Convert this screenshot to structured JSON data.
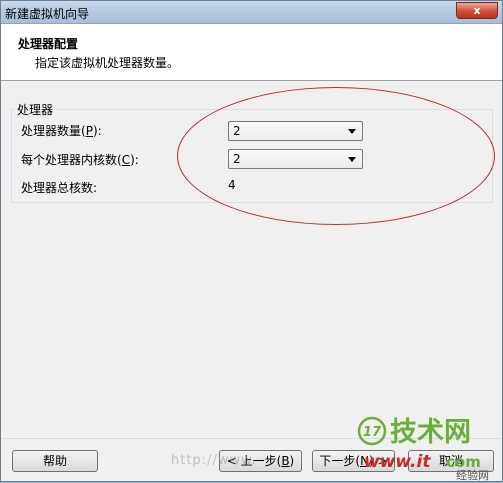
{
  "window": {
    "title": "新建虚拟机向导",
    "close_glyph": "x"
  },
  "header": {
    "title": "处理器配置",
    "subtitle": "指定该虚拟机处理器数量。"
  },
  "group": {
    "title": "处理器",
    "rows": [
      {
        "label_prefix": "处理器数量(",
        "accel": "P",
        "label_suffix": "):",
        "value": "2"
      },
      {
        "label_prefix": "每个处理器内核数(",
        "accel": "C",
        "label_suffix": "):",
        "value": "2"
      }
    ],
    "total_label": "处理器总核数:",
    "total_value": "4"
  },
  "buttons": {
    "help": "帮助",
    "back_prefix": "< 上一步(",
    "back_accel": "B",
    "back_suffix": ")",
    "next_prefix": "下一步(",
    "next_accel": "N",
    "next_suffix": ") >",
    "cancel": "取消"
  },
  "watermark": {
    "url": "http://www.",
    "logo_number": "17",
    "logo_cn": "技术网",
    "logo_site": "www.it",
    "logo_site_tail": "com",
    "logo_small": "经验网"
  },
  "colors": {
    "annotation": "#c0282e",
    "watermark_green": "#6cae3a",
    "watermark_red": "#c62a2a"
  }
}
